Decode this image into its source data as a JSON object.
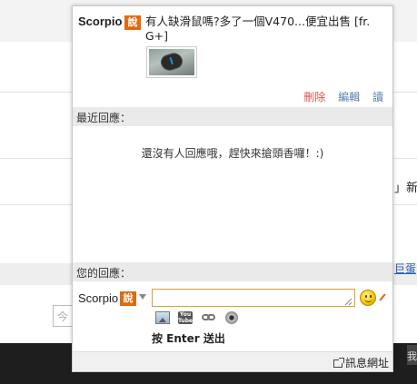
{
  "background_page": {
    "input_placeholder": "今",
    "right_fragment_1": "」新",
    "right_fragment_2": "巨蛋",
    "dark_bar_button": "我"
  },
  "post": {
    "author": "Scorpio",
    "badge": "說",
    "text": "有人缺滑鼠嗎?多了一個V470...便宜出售 [fr. G+]",
    "actions": {
      "delete": "刪除",
      "edit": "編輯",
      "read": "讀"
    }
  },
  "recent_replies": {
    "header": "最近回應：",
    "empty_message": "還沒有人回應哦，趕快來搶頭香囉！:)"
  },
  "your_reply": {
    "header": "您的回應：",
    "author": "Scorpio",
    "badge": "說",
    "input_value": "",
    "hint": "按 Enter 送出",
    "tools": [
      "image-icon",
      "youtube-icon",
      "link-icon",
      "webcam-icon"
    ],
    "youtube_icon_text": "You Tube"
  },
  "footer": {
    "link_label": "訊息網址"
  },
  "colors": {
    "badge": "#e06a12",
    "input_border": "#d8a032",
    "delete_action": "#d9534f",
    "link_action": "#5b7fb0",
    "section_bg": "#eaeaea"
  }
}
